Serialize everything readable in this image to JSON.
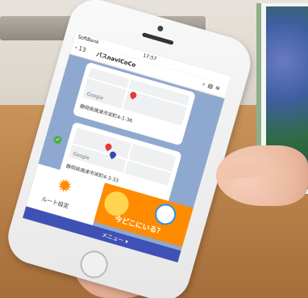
{
  "status_bar": {
    "carrier": "SoftBank",
    "time": "17:57"
  },
  "chat_header": {
    "back_count": "13",
    "title": "バスnaviCoCo",
    "icons": [
      "search-icon",
      "menu-icon",
      "list-icon"
    ]
  },
  "messages": [
    {
      "map_label": "Google",
      "address": "静岡県焼津市栄町4-1-36"
    },
    {
      "map_label": "Google",
      "address": "静岡県焼津市栄町4-3-33"
    }
  ],
  "rich_menu": {
    "route_label": "ルート設定",
    "banner_label": "今どこにいる？",
    "menu_label": "メニュー ▾"
  },
  "colors": {
    "banner": "#ff8c00",
    "menu_bar": "#3f51b5",
    "chat_bg": "#8fa8cf"
  }
}
